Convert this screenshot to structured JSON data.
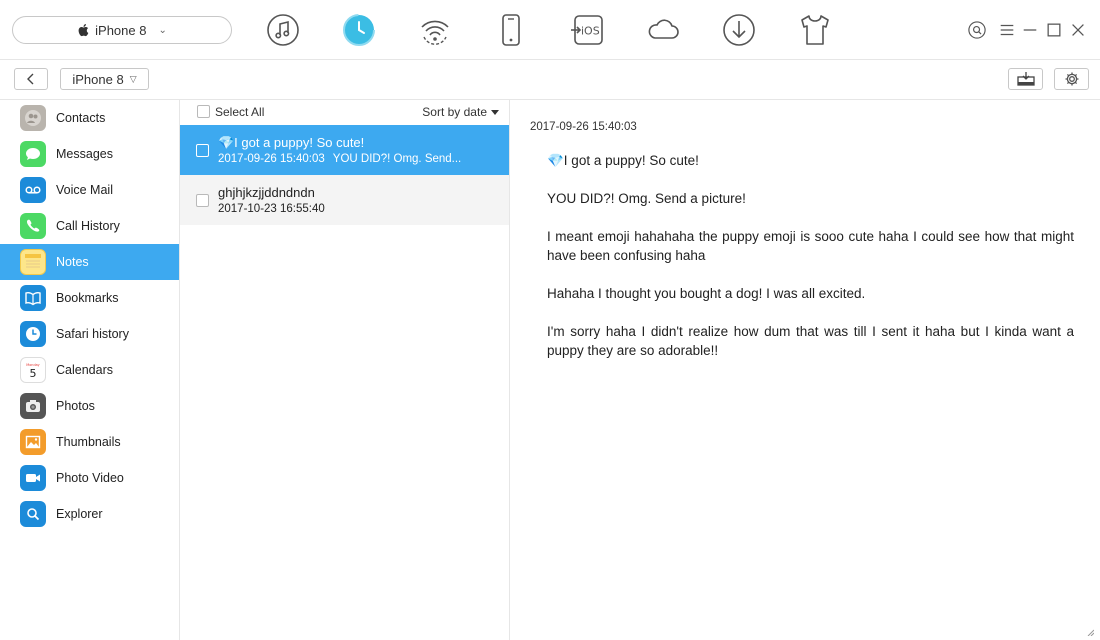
{
  "top": {
    "device_name": "iPhone 8",
    "tools": [
      "music-icon",
      "backup-history-icon",
      "wifi-sync-icon",
      "phone-icon",
      "ios-transfer-icon",
      "cloud-icon",
      "download-icon",
      "tshirt-icon"
    ]
  },
  "subbar": {
    "device_name": "iPhone 8"
  },
  "sidebar": {
    "items": [
      {
        "label": "Contacts",
        "icon": "contacts-icon"
      },
      {
        "label": "Messages",
        "icon": "messages-icon"
      },
      {
        "label": "Voice Mail",
        "icon": "voicemail-icon"
      },
      {
        "label": "Call History",
        "icon": "phone-icon"
      },
      {
        "label": "Notes",
        "icon": "notes-icon",
        "active": true
      },
      {
        "label": "Bookmarks",
        "icon": "bookmarks-icon"
      },
      {
        "label": "Safari history",
        "icon": "safari-history-icon"
      },
      {
        "label": "Calendars",
        "icon": "calendar-icon",
        "calendar_day_name": "Monday",
        "calendar_day_number": "5"
      },
      {
        "label": "Photos",
        "icon": "camera-icon"
      },
      {
        "label": "Thumbnails",
        "icon": "thumbnails-icon"
      },
      {
        "label": "Photo Video",
        "icon": "video-icon"
      },
      {
        "label": "Explorer",
        "icon": "explorer-search-icon"
      }
    ]
  },
  "list": {
    "select_all": "Select All",
    "sort_label": "Sort by date",
    "notes": [
      {
        "title": "💎I got a puppy! So cute!",
        "date": "2017-09-26 15:40:03",
        "preview": "YOU DID?! Omg. Send...",
        "active": true
      },
      {
        "title": "ghjhjkzjjddndndn",
        "date": "2017-10-23 16:55:40",
        "preview": ""
      }
    ]
  },
  "detail": {
    "date": "2017-09-26 15:40:03",
    "paragraphs": [
      "💎I got a puppy! So cute!",
      "YOU DID?! Omg. Send a picture!",
      "I meant emoji hahahaha the puppy emoji is sooo cute haha I could see how that might have been confusing haha",
      "Hahaha I thought you bought a dog! I was all excited.",
      "I'm sorry haha I didn't realize how dum that was till I sent it haha but I kinda want a puppy they are so adorable!!"
    ]
  },
  "colors": {
    "accent": "#3da9f0",
    "toolbar_icon": "#555555",
    "clock_accent": "#3bbde4"
  }
}
